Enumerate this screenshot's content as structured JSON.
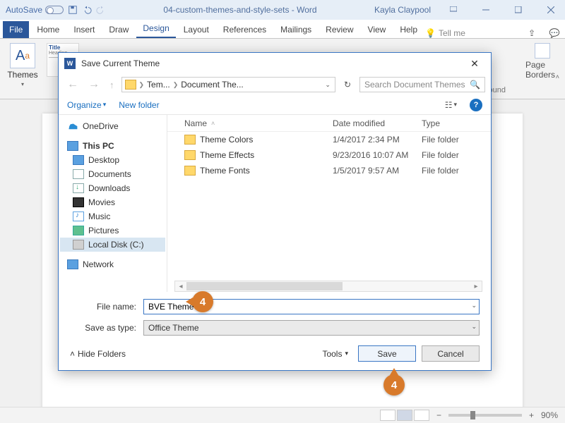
{
  "titlebar": {
    "autosave": "AutoSave",
    "doc": "04-custom-themes-and-style-sets - Word",
    "user": "Kayla Claypool"
  },
  "tabs": {
    "file": "File",
    "items": [
      "Home",
      "Insert",
      "Draw",
      "Design",
      "Layout",
      "References",
      "Mailings",
      "Review",
      "View",
      "Help"
    ],
    "active": "Design",
    "tellme": "Tell me"
  },
  "ribbon": {
    "themes": "Themes",
    "page_borders": "Page Borders",
    "rlabel": "ound"
  },
  "dialog": {
    "title": "Save Current Theme",
    "crumbs": [
      "Tem...",
      "Document The..."
    ],
    "search_placeholder": "Search Document Themes",
    "organize": "Organize",
    "new_folder": "New folder",
    "columns": {
      "name": "Name",
      "modified": "Date modified",
      "type": "Type"
    },
    "nav": {
      "onedrive": "OneDrive",
      "thispc": "This PC",
      "desktop": "Desktop",
      "documents": "Documents",
      "downloads": "Downloads",
      "movies": "Movies",
      "music": "Music",
      "pictures": "Pictures",
      "localdisk": "Local Disk (C:)",
      "network": "Network"
    },
    "files": [
      {
        "name": "Theme Colors",
        "modified": "1/4/2017 2:34 PM",
        "type": "File folder"
      },
      {
        "name": "Theme Effects",
        "modified": "9/23/2016 10:07 AM",
        "type": "File folder"
      },
      {
        "name": "Theme Fonts",
        "modified": "1/5/2017 9:57 AM",
        "type": "File folder"
      }
    ],
    "filename_label": "File name:",
    "filename_value": "BVE Theme",
    "saveastype_label": "Save as type:",
    "saveastype_value": "Office Theme",
    "hide_folders": "Hide Folders",
    "tools": "Tools",
    "save": "Save",
    "cancel": "Cancel"
  },
  "status": {
    "zoom": "90%"
  },
  "callouts": {
    "a": "4",
    "b": "4"
  }
}
